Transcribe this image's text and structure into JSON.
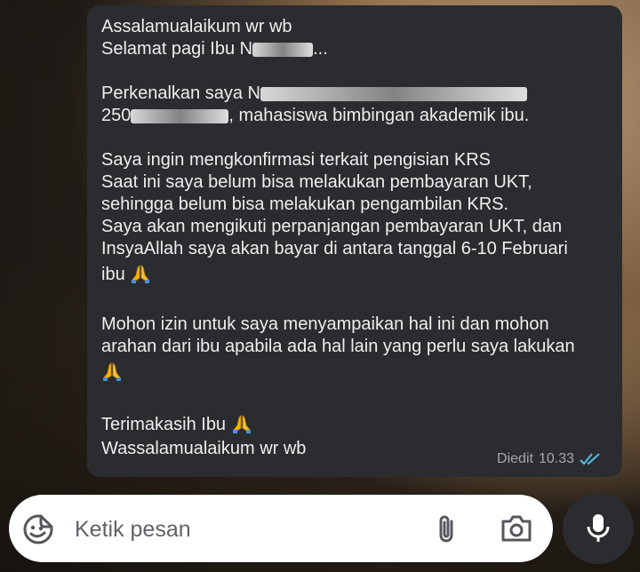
{
  "message": {
    "greeting_1": "Assalamualaikum wr wb",
    "greeting_2_prefix": "Selamat pagi Ibu N",
    "greeting_2_suffix": "...",
    "intro_prefix": "Perkenalkan saya N",
    "intro_line2_prefix": "250",
    "intro_line2_suffix": ", mahasiswa bimbingan akademik ibu.",
    "para2_line1": "Saya ingin mengkonfirmasi terkait pengisian KRS",
    "para2_line2": "Saat ini saya belum bisa melakukan pembayaran UKT,",
    "para2_line3": "sehingga belum bisa melakukan pengambilan KRS.",
    "para2_line4": "Saya akan mengikuti perpanjangan pembayaran UKT, dan",
    "para2_line5": "InsyaAllah saya akan bayar di antara tanggal 6-10 Februari",
    "para2_line6": "ibu",
    "para3_line1": "Mohon izin untuk saya menyampaikan hal ini dan mohon",
    "para3_line2": "arahan dari ibu apabila ada hal lain yang perlu saya lakukan",
    "closing_1": "Terimakasih Ibu",
    "closing_2": "Wassalamualaikum wr wb",
    "edited_label": "Diedit",
    "time": "10.33",
    "status_icon": "double-check-icon"
  },
  "composer": {
    "placeholder": "Ketik pesan",
    "emoji_icon": "sticker-emoji-icon",
    "attach_icon": "paperclip-icon",
    "camera_icon": "camera-icon",
    "mic_icon": "microphone-icon"
  },
  "colors": {
    "bubble": "#2b2c2f",
    "text": "#eeeeee",
    "meta": "#a4a7ad",
    "read_ticks": "#53bdeb",
    "input_bg": "#ffffff"
  }
}
